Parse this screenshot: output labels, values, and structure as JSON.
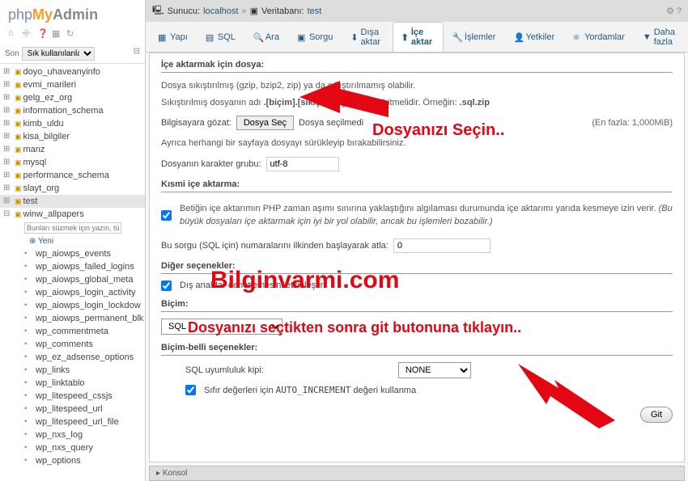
{
  "logo": {
    "php": "php",
    "my": "My",
    "admin": "Admin"
  },
  "recent": {
    "label": "Son",
    "placeholder": "Sık kullanılanlar"
  },
  "tree": {
    "items": [
      "doyo_uhaveanyinfo",
      "evmi_marileri",
      "gelg_ez_org",
      "information_schema",
      "kimb_uldu",
      "kisa_bilgiler",
      "manz",
      "mysql",
      "performance_schema",
      "slayt_org",
      "test",
      "winw_allpapers"
    ],
    "filter_ph": "Bunları süzmek için yazın, tür X",
    "new_label": "Yeni",
    "tables": [
      "wp_aiowps_events",
      "wp_aiowps_failed_logins",
      "wp_aiowps_global_meta",
      "wp_aiowps_login_activity",
      "wp_aiowps_login_lockdow",
      "wp_aiowps_permanent_blk",
      "wp_commentmeta",
      "wp_comments",
      "wp_ez_adsense_options",
      "wp_links",
      "wp_linktablo",
      "wp_litespeed_cssjs",
      "wp_litespeed_url",
      "wp_litespeed_url_file",
      "wp_nxs_log",
      "wp_nxs_query",
      "wp_options"
    ]
  },
  "breadcrumb": {
    "server_lbl": "Sunucu:",
    "server": "localhost",
    "db_lbl": "Veritabanı:",
    "db": "test"
  },
  "tabs": [
    "Yapı",
    "SQL",
    "Ara",
    "Sorgu",
    "Dışa aktar",
    "İçe aktar",
    "İşlemler",
    "Yetkiler",
    "Yordamlar",
    "Daha fazla"
  ],
  "import": {
    "h1": "İçe aktarmak için dosya:",
    "p1a": "Dosya sıkıştırılmış (gzip, bzip2, zip) ya da sıkıştırılmamış olabilir.",
    "p1b_a": "Sıkıştırılmış dosyanın adı ",
    "p1b_b": ".[biçim].[sıkıştırma]",
    "p1b_c": " şeklinde bitmelidir. Örneğin: ",
    "p1b_d": ".sql.zip",
    "browse_lbl": "Bilgisayara gözat:",
    "browse_btn": "Dosya Seç",
    "browse_none": "Dosya seçilmedi",
    "max": "(En fazla: 1,000MiB)",
    "drag": "Ayrıca herhangi bir sayfaya dosyayı sürükleyip bırakabilirsiniz.",
    "charset_lbl": "Dosyanın karakter grubu:",
    "charset": "utf-8",
    "h2": "Kısmi içe aktarma:",
    "p2a": "Betiğin içe aktarımın PHP zaman aşımı sınırına yaklaştığını algılaması durumunda içe aktarımı yarıda kesmeye izin verir. ",
    "p2b": "(Bu büyük dosyaları içe aktarmak için iyi bir yol olabilir, ancak bu işlemleri bozabilir.)",
    "skip_lbl": "Bu sorgu (SQL için) numaralarını ilkinden başlayarak atla:",
    "skip_val": "0",
    "h3": "Diğer seçenekler:",
    "fk": "Dış anahtar denetlemesini etkinleştir",
    "h4": "Biçim:",
    "format": "SQL",
    "h5": "Biçim-belli seçenekler:",
    "compat_lbl": "SQL uyumluluk kipi:",
    "compat": "NONE",
    "autoinc_a": "Sıfır değerleri için ",
    "autoinc_b": "AUTO_INCREMENT",
    "autoinc_c": " değeri kullanma",
    "go": "Git"
  },
  "konsol": "Konsol",
  "annotations": {
    "a1": "Dosyanızı Seçin..",
    "a2": "Bilginvarmi.com",
    "a3": "Dosyanızı seçtikten sonra git butonuna tıklayın.."
  }
}
